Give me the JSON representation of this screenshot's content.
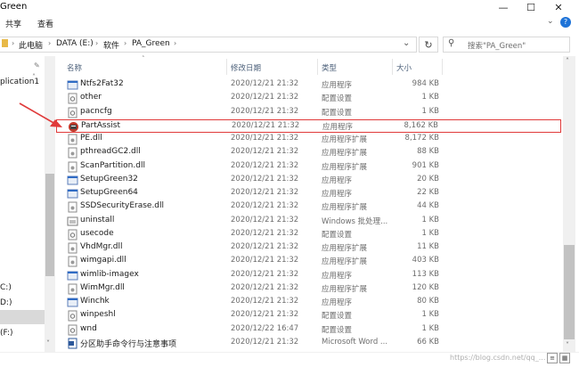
{
  "window": {
    "title": "Green",
    "minimize_glyph": "—",
    "maximize_glyph": "☐",
    "close_glyph": "✕",
    "help_glyph": "?",
    "expand_glyph": "⌄"
  },
  "ribbon": {
    "tabs": [
      "共享",
      "查看"
    ]
  },
  "address": {
    "crumbs": [
      "此电脑",
      "DATA (E:)",
      "软件",
      "PA_Green"
    ],
    "search_placeholder": "搜索\"PA_Green\""
  },
  "nav": {
    "items": [
      {
        "label": "plication1"
      },
      {
        "label": "C:)"
      },
      {
        "label": "D:)"
      },
      {
        "label": "(F:)"
      }
    ]
  },
  "columns": {
    "name": "名称",
    "date": "修改日期",
    "type": "类型",
    "size": "大小"
  },
  "files": [
    {
      "name": "Ntfs2Fat32",
      "date": "2020/12/21 21:32",
      "type": "应用程序",
      "size": "984 KB",
      "icon": "app-icon"
    },
    {
      "name": "other",
      "date": "2020/12/21 21:32",
      "type": "配置设置",
      "size": "1 KB",
      "icon": "config-icon"
    },
    {
      "name": "pacncfg",
      "date": "2020/12/21 21:32",
      "type": "配置设置",
      "size": "1 KB",
      "icon": "config-icon"
    },
    {
      "name": "PartAssist",
      "date": "2020/12/21 21:32",
      "type": "应用程序",
      "size": "8,162 KB",
      "icon": "partassist-icon"
    },
    {
      "name": "PE.dll",
      "date": "2020/12/21 21:32",
      "type": "应用程序扩展",
      "size": "8,172 KB",
      "icon": "dll-icon"
    },
    {
      "name": "pthreadGC2.dll",
      "date": "2020/12/21 21:32",
      "type": "应用程序扩展",
      "size": "88 KB",
      "icon": "dll-icon"
    },
    {
      "name": "ScanPartition.dll",
      "date": "2020/12/21 21:32",
      "type": "应用程序扩展",
      "size": "901 KB",
      "icon": "dll-icon"
    },
    {
      "name": "SetupGreen32",
      "date": "2020/12/21 21:32",
      "type": "应用程序",
      "size": "20 KB",
      "icon": "app-icon"
    },
    {
      "name": "SetupGreen64",
      "date": "2020/12/21 21:32",
      "type": "应用程序",
      "size": "22 KB",
      "icon": "app-icon"
    },
    {
      "name": "SSDSecurityErase.dll",
      "date": "2020/12/21 21:32",
      "type": "应用程序扩展",
      "size": "44 KB",
      "icon": "dll-icon"
    },
    {
      "name": "uninstall",
      "date": "2020/12/21 21:32",
      "type": "Windows 批处理...",
      "size": "1 KB",
      "icon": "batch-icon"
    },
    {
      "name": "usecode",
      "date": "2020/12/21 21:32",
      "type": "配置设置",
      "size": "1 KB",
      "icon": "config-icon"
    },
    {
      "name": "VhdMgr.dll",
      "date": "2020/12/21 21:32",
      "type": "应用程序扩展",
      "size": "11 KB",
      "icon": "dll-icon"
    },
    {
      "name": "wimgapi.dll",
      "date": "2020/12/21 21:32",
      "type": "应用程序扩展",
      "size": "403 KB",
      "icon": "dll-icon"
    },
    {
      "name": "wimlib-imagex",
      "date": "2020/12/21 21:32",
      "type": "应用程序",
      "size": "113 KB",
      "icon": "app-icon"
    },
    {
      "name": "WimMgr.dll",
      "date": "2020/12/21 21:32",
      "type": "应用程序扩展",
      "size": "120 KB",
      "icon": "dll-icon"
    },
    {
      "name": "Winchk",
      "date": "2020/12/21 21:32",
      "type": "应用程序",
      "size": "80 KB",
      "icon": "app-icon"
    },
    {
      "name": "winpeshl",
      "date": "2020/12/21 21:32",
      "type": "配置设置",
      "size": "1 KB",
      "icon": "config-icon"
    },
    {
      "name": "wnd",
      "date": "2020/12/22 16:47",
      "type": "配置设置",
      "size": "1 KB",
      "icon": "config-icon"
    },
    {
      "name": "分区助手命令行与注意事项",
      "date": "2020/12/21 21:32",
      "type": "Microsoft Word ...",
      "size": "66 KB",
      "icon": "word-icon"
    }
  ],
  "highlighted_file": "PartAssist",
  "status": {
    "watermark": "https://blog.csdn.net/qq_..."
  },
  "colors": {
    "highlight_border": "#e03a3a",
    "arrow": "#e03a3a",
    "header_text": "#4c607a"
  }
}
